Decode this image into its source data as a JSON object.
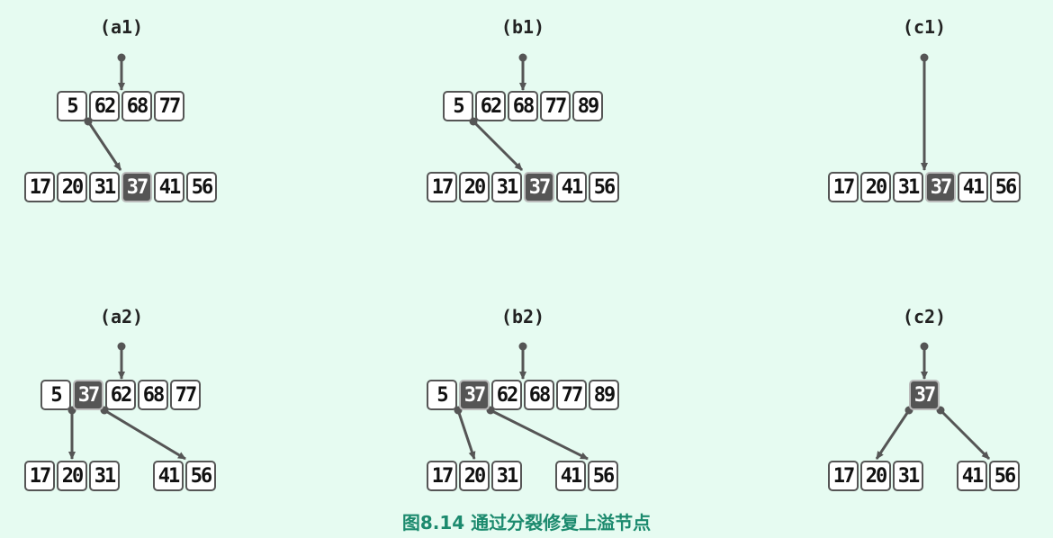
{
  "caption": "图8.14  通过分裂修复上溢节点",
  "panels": [
    {
      "label": "(a1)",
      "nodes": [
        {
          "keys": [
            "5",
            "62",
            "68",
            "77"
          ],
          "hl": []
        },
        {
          "keys": [
            "17",
            "20",
            "31",
            "37",
            "41",
            "56"
          ],
          "hl": [
            3
          ]
        }
      ]
    },
    {
      "label": "(b1)",
      "nodes": [
        {
          "keys": [
            "5",
            "62",
            "68",
            "77",
            "89"
          ],
          "hl": []
        },
        {
          "keys": [
            "17",
            "20",
            "31",
            "37",
            "41",
            "56"
          ],
          "hl": [
            3
          ]
        }
      ]
    },
    {
      "label": "(c1)",
      "nodes": [
        {
          "keys": [
            "17",
            "20",
            "31",
            "37",
            "41",
            "56"
          ],
          "hl": [
            3
          ]
        }
      ]
    },
    {
      "label": "(a2)",
      "nodes": [
        {
          "keys": [
            "5",
            "37",
            "62",
            "68",
            "77"
          ],
          "hl": [
            1
          ]
        },
        {
          "keys": [
            "17",
            "20",
            "31"
          ],
          "hl": []
        },
        {
          "keys": [
            "41",
            "56"
          ],
          "hl": []
        }
      ]
    },
    {
      "label": "(b2)",
      "nodes": [
        {
          "keys": [
            "5",
            "37",
            "62",
            "68",
            "77",
            "89"
          ],
          "hl": [
            1
          ]
        },
        {
          "keys": [
            "17",
            "20",
            "31"
          ],
          "hl": []
        },
        {
          "keys": [
            "41",
            "56"
          ],
          "hl": []
        }
      ]
    },
    {
      "label": "(c2)",
      "nodes": [
        {
          "keys": [
            "37"
          ],
          "hl": [
            0
          ]
        },
        {
          "keys": [
            "17",
            "20",
            "31"
          ],
          "hl": []
        },
        {
          "keys": [
            "41",
            "56"
          ],
          "hl": []
        }
      ]
    }
  ]
}
